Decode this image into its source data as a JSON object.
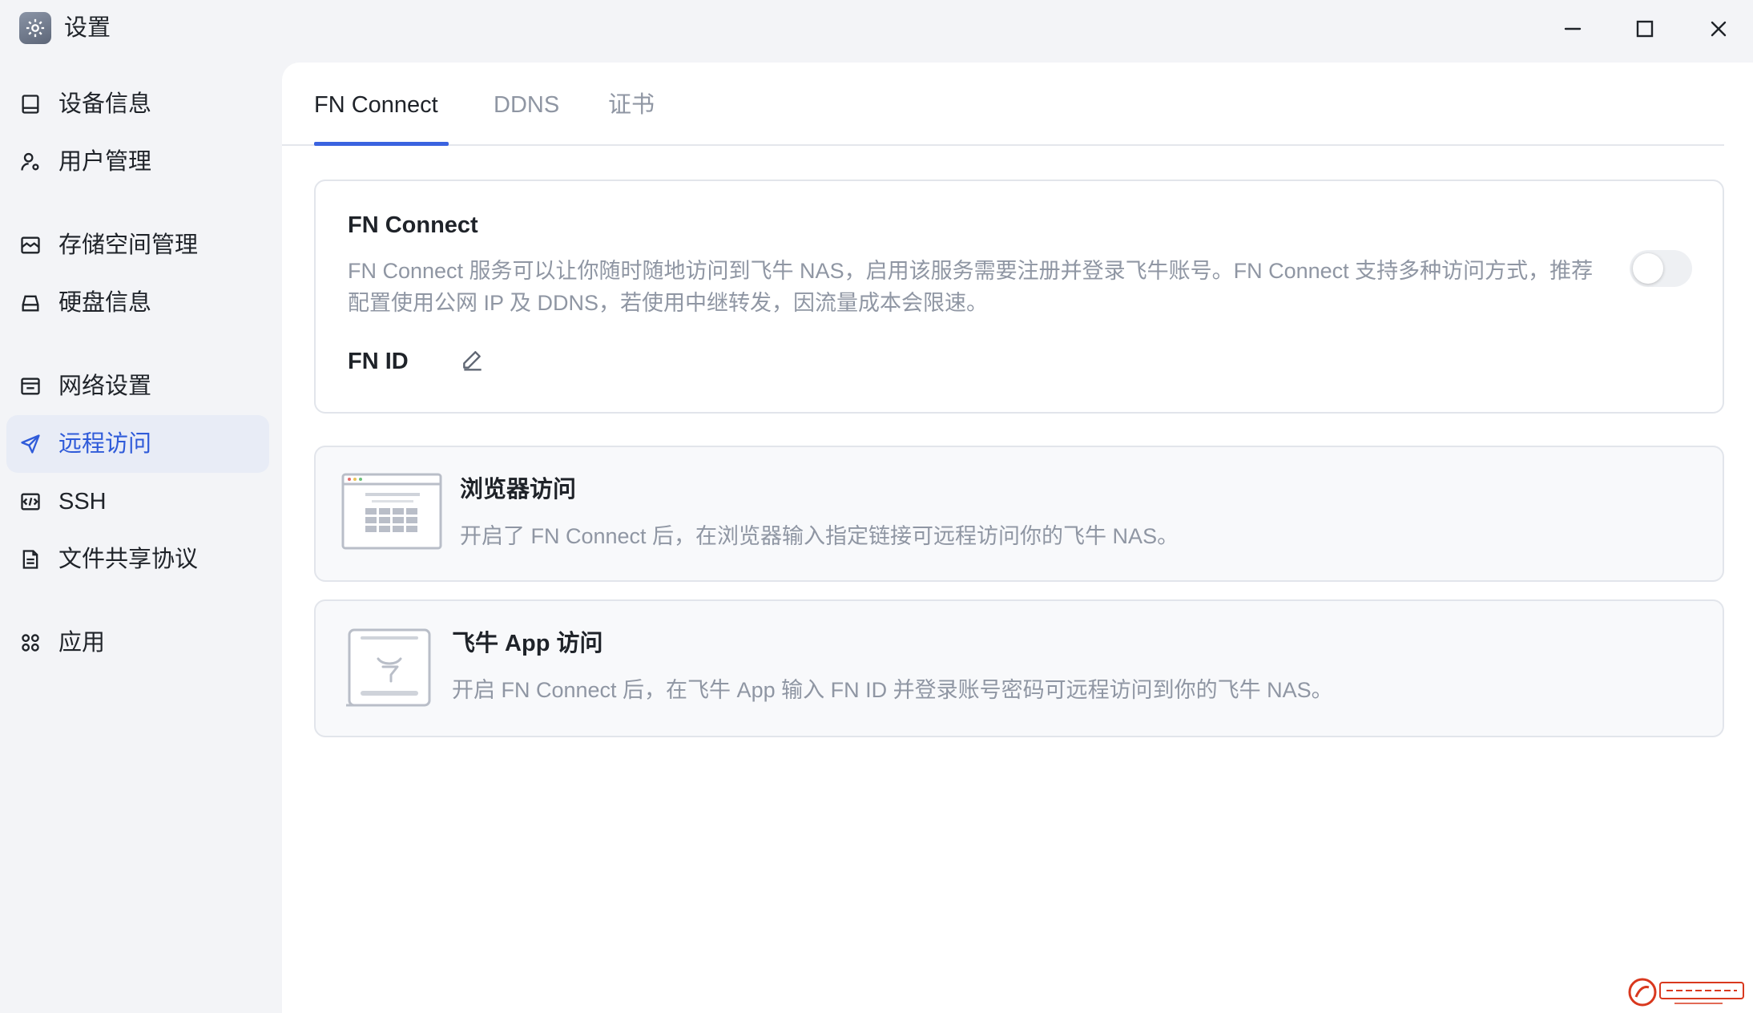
{
  "window": {
    "title": "设置",
    "controls": {
      "minimize": "minimize-icon",
      "maximize": "maximize-icon",
      "close": "close-icon"
    }
  },
  "sidebar": {
    "items": [
      {
        "label": "设备信息",
        "icon": "device-icon"
      },
      {
        "label": "用户管理",
        "icon": "user-settings-icon"
      },
      {
        "label": "存储空间管理",
        "icon": "storage-icon"
      },
      {
        "label": "硬盘信息",
        "icon": "disk-icon"
      },
      {
        "label": "网络设置",
        "icon": "network-icon"
      },
      {
        "label": "远程访问",
        "icon": "send-icon",
        "active": true
      },
      {
        "label": "SSH",
        "icon": "terminal-icon"
      },
      {
        "label": "文件共享协议",
        "icon": "file-share-icon"
      },
      {
        "label": "应用",
        "icon": "apps-icon"
      }
    ]
  },
  "tabs": [
    {
      "label": "FN Connect",
      "active": true
    },
    {
      "label": "DDNS"
    },
    {
      "label": "证书"
    }
  ],
  "fn_connect": {
    "title": "FN Connect",
    "description": "FN Connect 服务可以让你随时随地访问到飞牛 NAS，启用该服务需要注册并登录飞牛账号。FN Connect 支持多种访问方式，推荐配置使用公网 IP 及 DDNS，若使用中继转发，因流量成本会限速。",
    "enabled": false,
    "fn_id_label": "FN ID"
  },
  "access_methods": [
    {
      "title": "浏览器访问",
      "description": "开启了 FN Connect 后，在浏览器输入指定链接可远程访问你的飞牛 NAS。",
      "illustration": "browser-illustration-icon"
    },
    {
      "title": "飞牛 App 访问",
      "description": "开启 FN Connect 后，在飞牛 App 输入 FN ID 并登录账号密码可远程访问到你的飞牛 NAS。",
      "illustration": "app-illustration-icon"
    }
  ],
  "colors": {
    "accent": "#3a63e0",
    "active_bg": "#e8ecf6",
    "muted_text": "#8f96a3",
    "background": "#f3f4f7"
  }
}
